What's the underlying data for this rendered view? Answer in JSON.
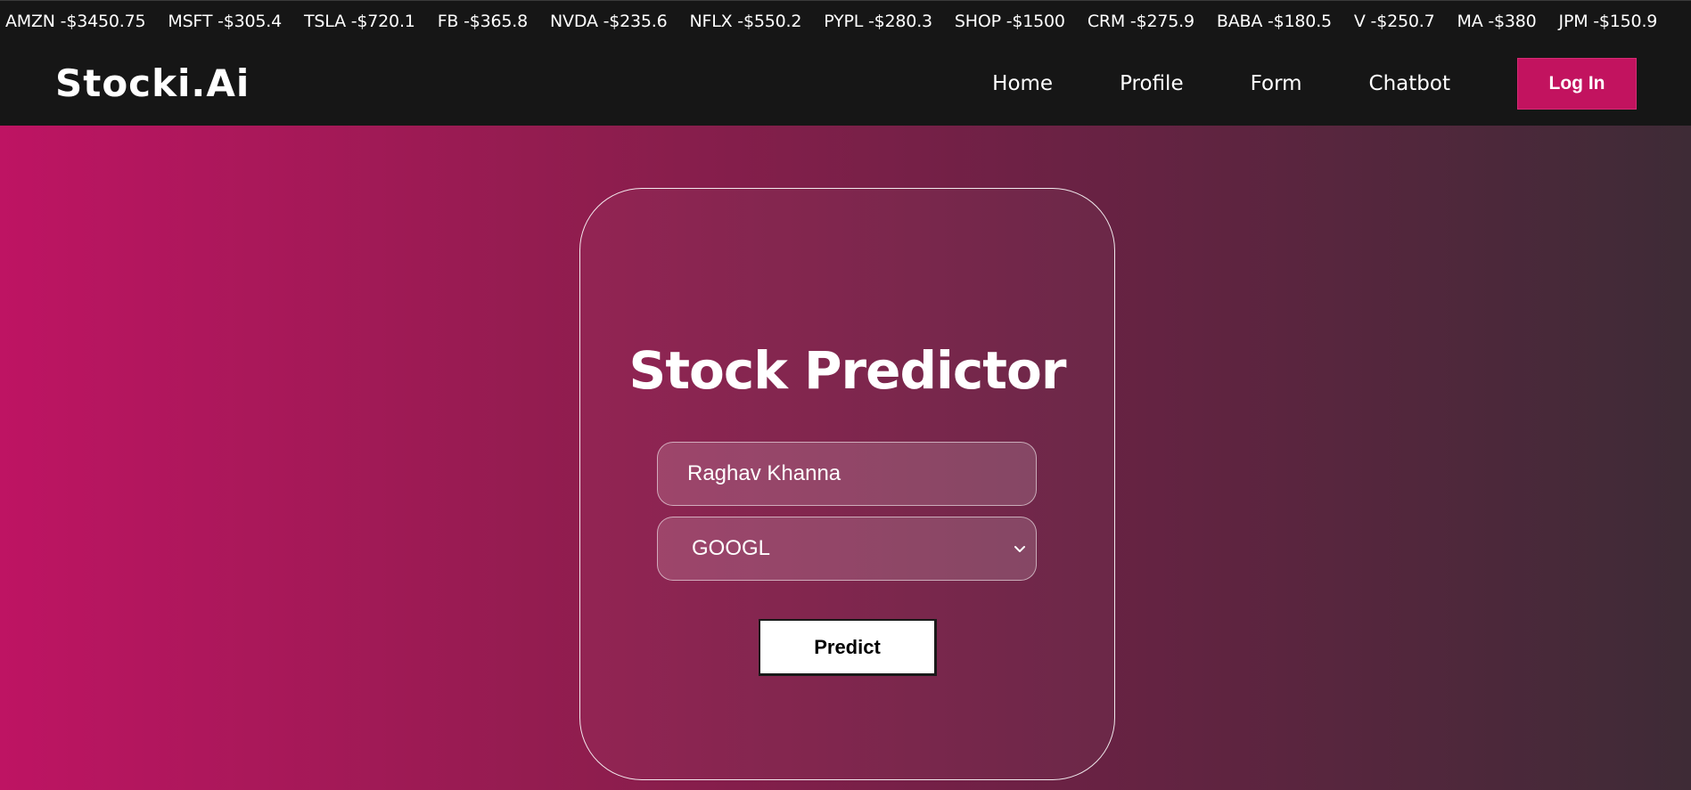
{
  "ticker": [
    {
      "label": "AMZN -$3450.75"
    },
    {
      "label": "MSFT -$305.4"
    },
    {
      "label": "TSLA -$720.1"
    },
    {
      "label": "FB -$365.8"
    },
    {
      "label": "NVDA -$235.6"
    },
    {
      "label": "NFLX -$550.2"
    },
    {
      "label": "PYPL -$280.3"
    },
    {
      "label": "SHOP -$1500"
    },
    {
      "label": "CRM -$275.9"
    },
    {
      "label": "BABA -$180.5"
    },
    {
      "label": "V -$250.7"
    },
    {
      "label": "MA -$380"
    },
    {
      "label": "JPM -$150.9"
    }
  ],
  "nav": {
    "brand": "Stocki.Ai",
    "links": [
      "Home",
      "Profile",
      "Form",
      "Chatbot"
    ],
    "login_label": "Log In"
  },
  "form": {
    "title": "Stock Predictor",
    "name_value": "Raghav Khanna",
    "selected_stock": "GOOGL",
    "predict_label": "Predict"
  },
  "colors": {
    "accent": "#c2135f",
    "navbar_bg": "#161616"
  },
  "icons": {
    "select_arrow": "chevron-down-icon"
  }
}
